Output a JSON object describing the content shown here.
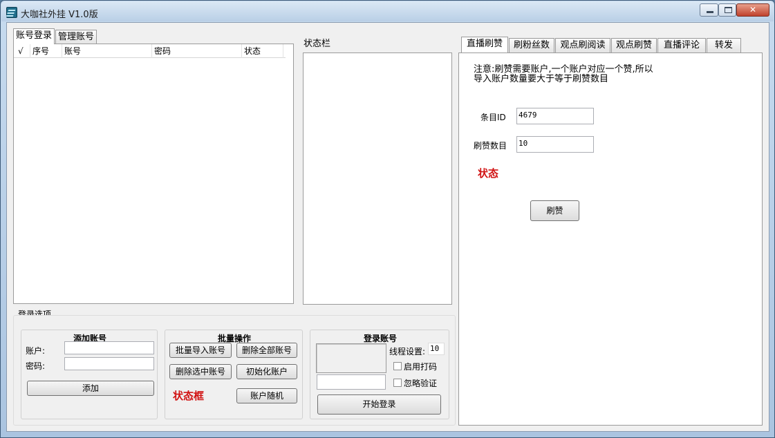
{
  "window": {
    "title": "大咖社外挂 V1.0版",
    "close_glyph": "✕",
    "min_icon": "minimize-icon",
    "max_icon": "maximize-icon"
  },
  "left_tabs": [
    "账号登录",
    "管理账号"
  ],
  "account_table": {
    "columns": [
      "√",
      "序号",
      "账号",
      "密码",
      "状态"
    ]
  },
  "status_bar": {
    "label": "状态栏"
  },
  "login_options": {
    "title": "登录选项",
    "add_account": {
      "title": "添加账号",
      "account_label": "账户:",
      "password_label": "密码:",
      "account_value": "",
      "password_value": "",
      "add_button": "添加"
    },
    "batch": {
      "title": "批量操作",
      "import_button": "批量导入账号",
      "delete_all_button": "删除全部账号",
      "delete_selected_button": "删除选中账号",
      "init_button": "初始化账户",
      "status_box_label": "状态框",
      "random_button": "账户随机"
    },
    "login": {
      "title": "登录账号",
      "thread_label": "线程设置:",
      "thread_value": "10",
      "captcha_label": "启用打码",
      "ignore_verify_label": "忽略验证",
      "start_button": "开始登录"
    }
  },
  "right_tabs": [
    "直播刷赞",
    "刷粉丝数",
    "观点刷阅读",
    "观点刷赞",
    "直播评论",
    "转发"
  ],
  "like_panel": {
    "notice": "注意:刷赞需要账户,一个账户对应一个赞,所以导入账户数量要大于等于刷赞数目",
    "item_id_label": "条目ID",
    "item_id_value": "4679",
    "count_label": "刷赞数目",
    "count_value": "10",
    "status_label": "状态",
    "submit_button": "刷赞"
  },
  "colors": {
    "accent_red": "#d11212",
    "titlebar": "#c7dbef",
    "client_bg": "#f0f0f0"
  }
}
